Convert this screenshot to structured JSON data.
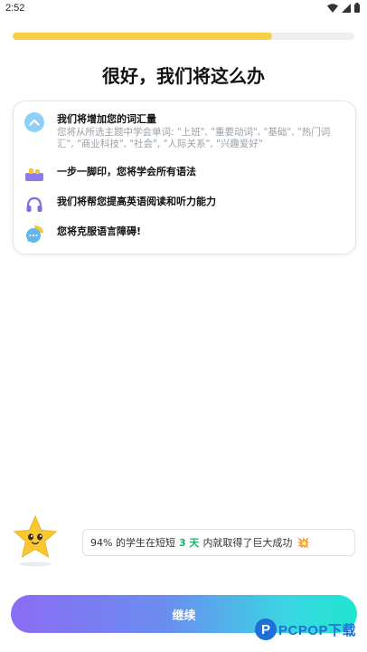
{
  "status_bar": {
    "time": "2:52",
    "icons": [
      "wifi-icon",
      "signal-icon",
      "battery-icon"
    ]
  },
  "progress": {
    "fraction": 0.76,
    "color": "#f7cf45"
  },
  "title": "很好，我们将这么办",
  "features": [
    {
      "icon": "chevron-up-circle-icon",
      "title": "我们将增加您的词汇量",
      "desc": "您将从所选主题中学会单词: \"上班\", \"重要动词\", \"基础\", \"热门词汇\", \"商业科技\", \"社会\", \"人际关系\", \"兴趣爱好\""
    },
    {
      "icon": "footprint-icon",
      "title": "一步一脚印，您将学会所有语法"
    },
    {
      "icon": "headphones-icon",
      "title": "我们将帮您提高英语阅读和听力能力"
    },
    {
      "icon": "chat-bubble-icon",
      "title": "您将克服语言障碍!"
    }
  ],
  "promo": {
    "prefix": "94% 的学生在短短",
    "highlight": "3 天",
    "suffix": "内就取得了巨大成功",
    "emoji": "💥"
  },
  "button": {
    "label": "继续"
  },
  "watermark": {
    "logo": "P",
    "text": "PCPOP下载"
  }
}
